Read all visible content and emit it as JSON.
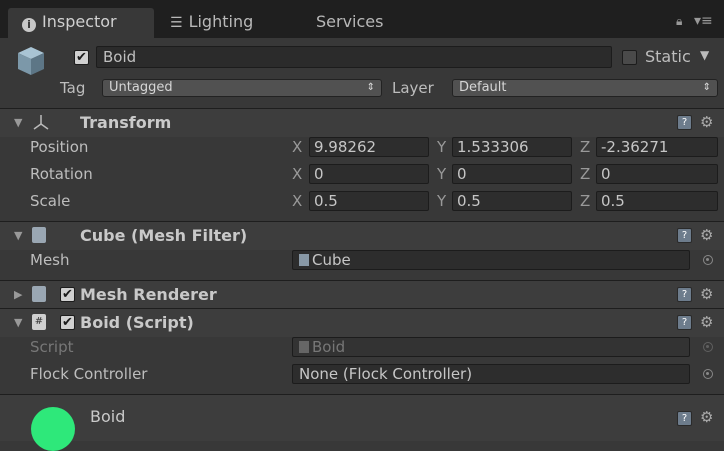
{
  "tabs": [
    {
      "label": "Inspector",
      "active": true,
      "icon": "info-icon"
    },
    {
      "label": "Lighting",
      "active": false,
      "icon": "sliders-icon"
    },
    {
      "label": "Services",
      "active": false
    }
  ],
  "header": {
    "object_name": "Boid",
    "active": true,
    "static_label": "Static",
    "static": false,
    "tag_label": "Tag",
    "tag_value": "Untagged",
    "layer_label": "Layer",
    "layer_value": "Default"
  },
  "transform": {
    "title": "Transform",
    "rows": [
      {
        "label": "Position",
        "x": "9.98262",
        "y": "1.533306",
        "z": "-2.36271"
      },
      {
        "label": "Rotation",
        "x": "0",
        "y": "0",
        "z": "0"
      },
      {
        "label": "Scale",
        "x": "0.5",
        "y": "0.5",
        "z": "0.5"
      }
    ],
    "axis": {
      "x": "X",
      "y": "Y",
      "z": "Z"
    }
  },
  "mesh_filter": {
    "title": "Cube (Mesh Filter)",
    "mesh_label": "Mesh",
    "mesh_value": "Cube"
  },
  "mesh_renderer": {
    "title": "Mesh Renderer",
    "enabled": true
  },
  "boid_script": {
    "title": "Boid (Script)",
    "enabled": true,
    "script_label": "Script",
    "script_value": "Boid",
    "flock_label": "Flock Controller",
    "flock_value": "None (Flock Controller)"
  },
  "material": {
    "name": "Boid",
    "color": "#2ee87a"
  },
  "colors": {
    "panel": "#383838",
    "tabbar": "#1f1f1f",
    "accent_green": "#2ee87a"
  }
}
